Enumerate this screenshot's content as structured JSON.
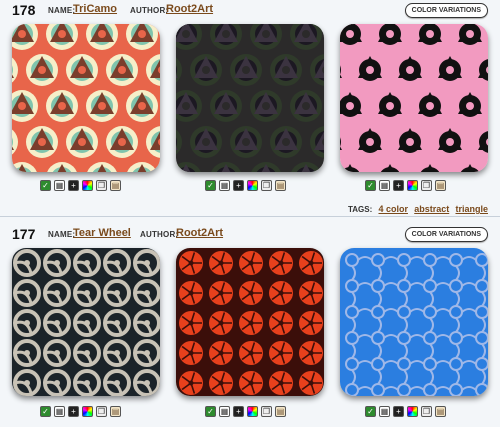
{
  "entries": [
    {
      "number": "178",
      "name_label": "NAME:",
      "name": "TriCamo",
      "author_label": "AUTHOR:",
      "author": "Root2Art",
      "color_button": "COLOR VARIATIONS",
      "tags_label": "TAGS:",
      "tags": [
        "4 color",
        "abstract",
        "triangle"
      ],
      "tiles": [
        {
          "bg": "#e8654a",
          "c1": "#7a3e2c",
          "c2": "#7fc4ad",
          "c3": "#f6efc9",
          "kind": "tricamo"
        },
        {
          "bg": "#2b2a2a",
          "c1": "#3b3340",
          "c2": "#1c1822",
          "c3": "#2f3a2a",
          "kind": "tricamo"
        },
        {
          "bg": "#f29ac0",
          "c1": "#111111",
          "c2": "#111111",
          "c3": "#f29ac0",
          "kind": "tricamo"
        }
      ]
    },
    {
      "number": "177",
      "name_label": "NAME:",
      "name": "Tear Wheel",
      "author_label": "AUTHOR:",
      "author": "Root2Art",
      "color_button": "COLOR VARIATIONS",
      "tiles": [
        {
          "bg": "#1b2329",
          "c1": "#c8c2b6",
          "kind": "wheel"
        },
        {
          "bg": "#3b0e0a",
          "c1": "#e8401c",
          "kind": "wheel2"
        },
        {
          "bg": "#2b7ee0",
          "c1": "#9fb8e8",
          "kind": "puzzle"
        }
      ]
    }
  ],
  "icon_names": [
    "download-icon",
    "grid-icon",
    "plus-icon",
    "rgb-icon",
    "copy-icon",
    "palette-icon"
  ]
}
